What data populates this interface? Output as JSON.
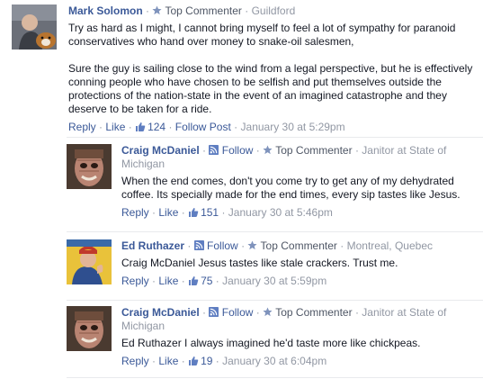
{
  "sep": "·",
  "comments": [
    {
      "author": "Mark Solomon",
      "badge": "Top Commenter",
      "location": "Guildford",
      "paragraphs": [
        "Try as hard as I might, I cannot bring myself to feel a lot of sympathy for paranoid conservatives who hand over money to snake-oil salesmen,",
        "Sure the guy is sailing close to the wind from a legal perspective, but he is effectively conning people who have chosen to be selfish and put themselves outside the protections of the nation-state in the event of an imagined catastrophe and they deserve to be taken for a ride."
      ],
      "actions": {
        "reply": "Reply",
        "like": "Like",
        "likes": "124",
        "follow_post": "Follow Post",
        "time": "January 30 at 5:29pm"
      }
    },
    {
      "author": "Craig McDaniel",
      "follow": "Follow",
      "badge": "Top Commenter",
      "job_prefix": "Janitor at",
      "workplace": "State of Michigan",
      "text": "When the end comes, don't you come try to get any of my dehydrated coffee. Its specially made for the end times, every sip tastes like Jesus.",
      "actions": {
        "reply": "Reply",
        "like": "Like",
        "likes": "151",
        "time": "January 30 at 5:46pm"
      }
    },
    {
      "author": "Ed Ruthazer",
      "follow": "Follow",
      "badge": "Top Commenter",
      "location": "Montreal, Quebec",
      "text": "Craig McDaniel Jesus tastes like stale crackers. Trust me.",
      "actions": {
        "reply": "Reply",
        "like": "Like",
        "likes": "75",
        "time": "January 30 at 5:59pm"
      }
    },
    {
      "author": "Craig McDaniel",
      "follow": "Follow",
      "badge": "Top Commenter",
      "job_prefix": "Janitor at",
      "workplace": "State of Michigan",
      "text": "Ed Ruthazer I always imagined he'd taste more like chickpeas.",
      "actions": {
        "reply": "Reply",
        "like": "Like",
        "likes": "19",
        "time": "January 30 at 6:04pm"
      }
    }
  ],
  "colors": {
    "link": "#3b5998",
    "meta": "#9197a3",
    "text": "#141823"
  }
}
